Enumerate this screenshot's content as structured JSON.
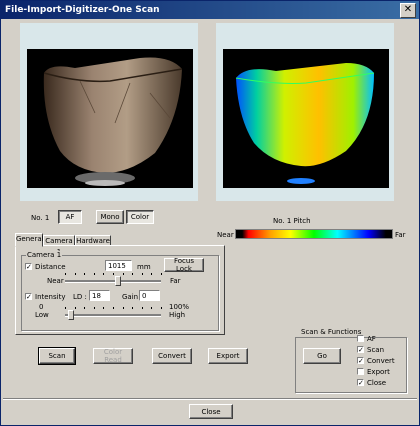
{
  "window": {
    "title": "File-Import-Digitizer-One Scan",
    "close_glyph": "✕"
  },
  "left_panel": {
    "scan_label": "No. 1",
    "af_button": "AF",
    "mono_button": "Mono",
    "color_button": "Color"
  },
  "right_panel": {
    "pitch_label": "No. 1 Pitch",
    "near_label": "Near",
    "far_label": "Far"
  },
  "tabs": [
    "General",
    "Camera 1",
    "Hardware"
  ],
  "camera_group": {
    "title": "Camera 1",
    "distance_label": "Distance",
    "distance_checked": true,
    "distance_value": "1015",
    "distance_unit": "mm",
    "focus_lock_button": "Focus Lock",
    "near_label": "Near",
    "far_label": "Far",
    "distance_slider_fraction": 0.55,
    "intensity_label": "Intensity",
    "intensity_checked": true,
    "ld_label": "LD :",
    "ld_value": "18",
    "gain_label": "Gain :",
    "gain_value": "0",
    "min_label": "0",
    "max_label": "100%",
    "low_label": "Low",
    "high_label": "High",
    "intensity_slider_fraction": 0.03
  },
  "actions": {
    "scan": "Scan",
    "color_read": "Color Read",
    "convert": "Convert",
    "export": "Export"
  },
  "scan_functions": {
    "title": "Scan & Functions",
    "go_button": "Go",
    "options": [
      {
        "label": "AF",
        "checked": false
      },
      {
        "label": "Scan",
        "checked": true
      },
      {
        "label": "Convert",
        "checked": true
      },
      {
        "label": "Export",
        "checked": false
      },
      {
        "label": "Close",
        "checked": true
      }
    ]
  },
  "footer": {
    "close_button": "Close"
  },
  "colors": {
    "title_start": "#0a246a",
    "title_end": "#3a6ea5",
    "viewport_bg": "#d9e7ea"
  }
}
